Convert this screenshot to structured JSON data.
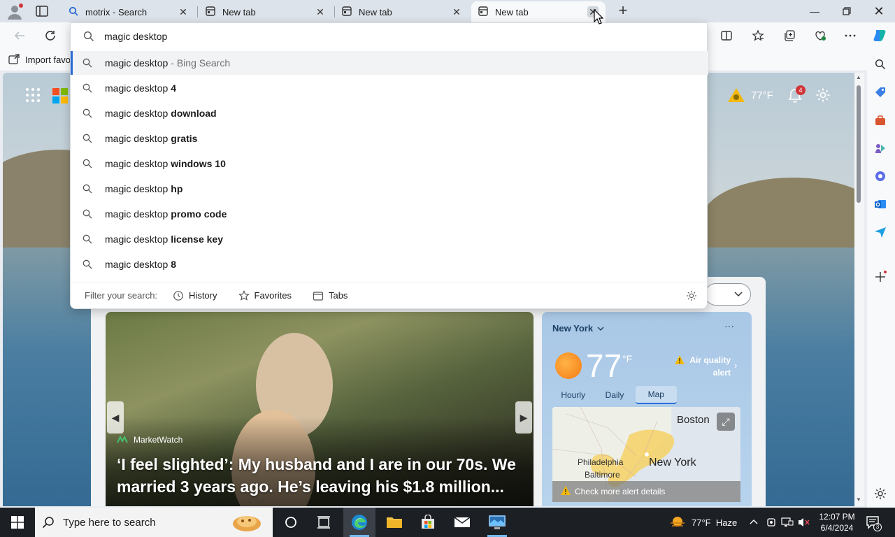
{
  "tabs": [
    {
      "label": "motrix - Search",
      "icon": "search-icon"
    },
    {
      "label": "New tab",
      "icon": "new-tab-page-icon"
    },
    {
      "label": "New tab",
      "icon": "new-tab-page-icon"
    },
    {
      "label": "New tab",
      "icon": "new-tab-page-icon",
      "active": true
    }
  ],
  "address": {
    "value": "magic desktop"
  },
  "favorites_bar": {
    "import_label": "Import favo"
  },
  "suggestions": [
    {
      "base": "magic desktop",
      "bold": "",
      "suffix": "- Bing Search"
    },
    {
      "base": "magic desktop",
      "bold": "4",
      "suffix": ""
    },
    {
      "base": "magic desktop",
      "bold": "download",
      "suffix": ""
    },
    {
      "base": "magic desktop",
      "bold": "gratis",
      "suffix": ""
    },
    {
      "base": "magic desktop",
      "bold": "windows 10",
      "suffix": ""
    },
    {
      "base": "magic desktop",
      "bold": "hp",
      "suffix": ""
    },
    {
      "base": "magic desktop",
      "bold": "promo code",
      "suffix": ""
    },
    {
      "base": "magic desktop",
      "bold": "license key",
      "suffix": ""
    },
    {
      "base": "magic desktop",
      "bold": "8",
      "suffix": ""
    }
  ],
  "filter": {
    "label": "Filter your search:",
    "history": "History",
    "favorites": "Favorites",
    "tabs": "Tabs"
  },
  "ntp": {
    "weather_temp": "77°F",
    "notifications": "4"
  },
  "hero": {
    "source": "MarketWatch",
    "title": "‘I feel slighted’: My husband and I are in our 70s. We married 3 years ago. He’s leaving his $1.8 million..."
  },
  "weather": {
    "city": "New York",
    "temp": "77",
    "unit": "°F",
    "alert": "Air quality alert",
    "tabs": [
      "Hourly",
      "Daily",
      "Map"
    ],
    "selected_tab": "Map",
    "map_labels": {
      "boston": "Boston",
      "new_york": "New York",
      "philadelphia": "Philadelphia",
      "baltimore": "Baltimore"
    },
    "alert_bar": "Check more alert details"
  },
  "taskbar": {
    "search_placeholder": "Type here to search",
    "weather": "77°F  Haze",
    "time": "12:07 PM",
    "date": "6/4/2024",
    "notification_count": "3"
  },
  "colors": {
    "accent": "#2b6bd4",
    "taskbar": "#1c1f24",
    "alert": "#f2b90f"
  }
}
